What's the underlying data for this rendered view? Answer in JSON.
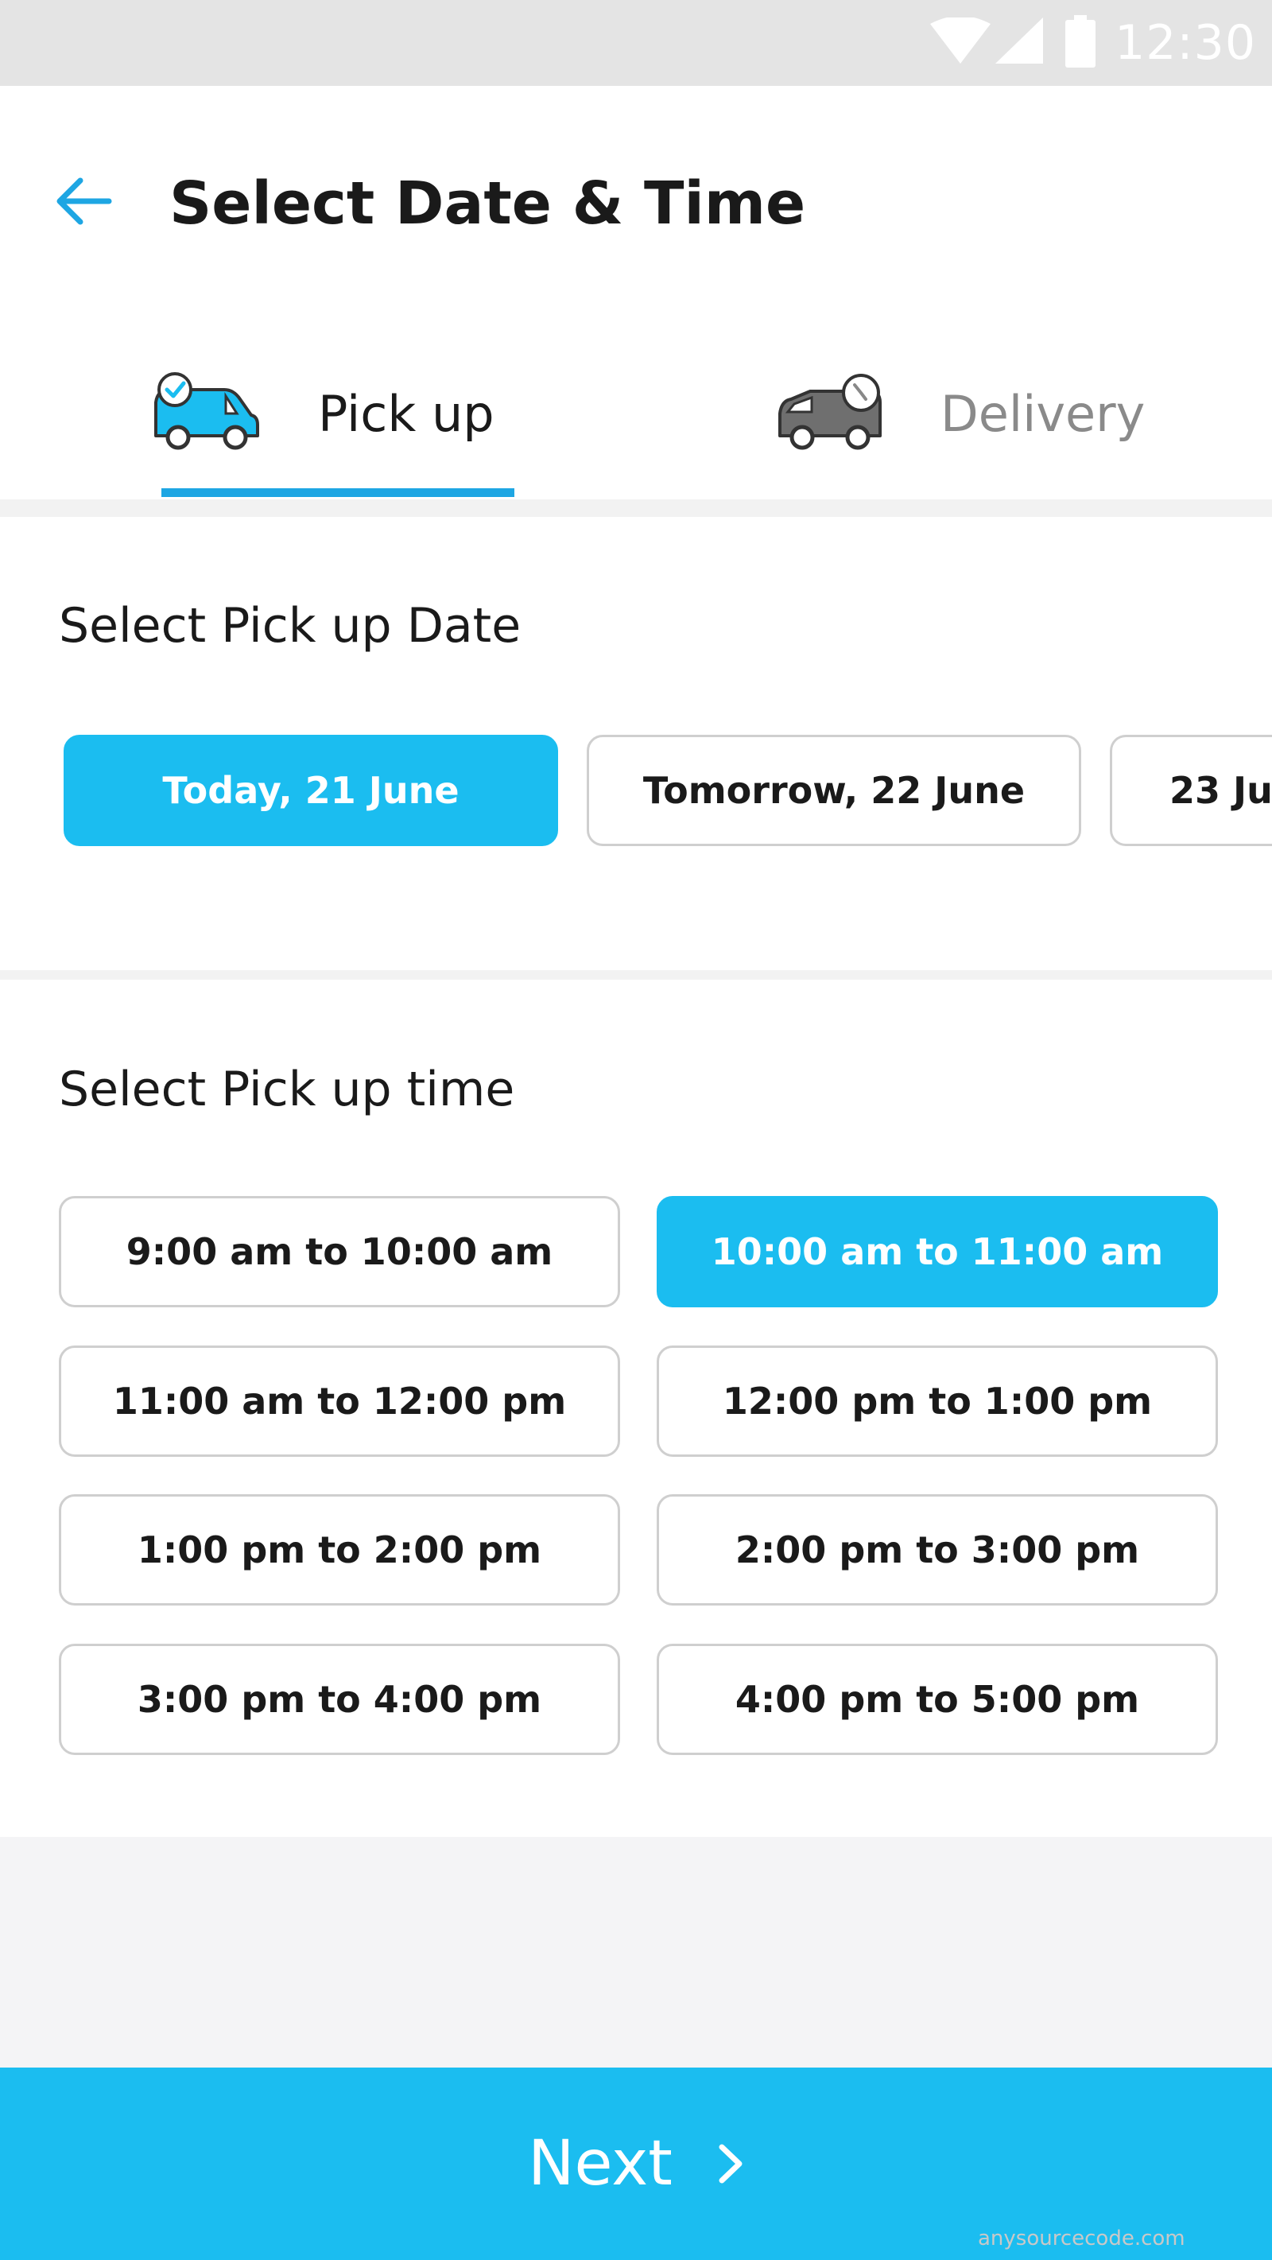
{
  "status_bar": {
    "time": "12:30",
    "icons": [
      "wifi-icon",
      "signal-icon",
      "battery-icon"
    ]
  },
  "header": {
    "title": "Select Date & Time",
    "back_icon": "arrow-left-icon"
  },
  "tabs": [
    {
      "label": "Pick up",
      "icon": "van-check-icon",
      "active": true
    },
    {
      "label": "Delivery",
      "icon": "van-clock-icon",
      "active": false
    }
  ],
  "date_section": {
    "title": "Select Pick up Date",
    "dates": [
      {
        "label": "Today, 21 June",
        "selected": true
      },
      {
        "label": "Tomorrow, 22 June",
        "selected": false
      },
      {
        "label": "23 Ju",
        "selected": false
      }
    ]
  },
  "time_section": {
    "title": "Select Pick up time",
    "slots": [
      {
        "label": "9:00 am to 10:00 am",
        "selected": false
      },
      {
        "label": "10:00 am to 11:00 am",
        "selected": true
      },
      {
        "label": "11:00 am to 12:00 pm",
        "selected": false
      },
      {
        "label": "12:00 pm to 1:00 pm",
        "selected": false
      },
      {
        "label": "1:00 pm to 2:00 pm",
        "selected": false
      },
      {
        "label": "2:00 pm to 3:00 pm",
        "selected": false
      },
      {
        "label": "3:00 pm to 4:00 pm",
        "selected": false
      },
      {
        "label": "4:00 pm to 5:00 pm",
        "selected": false
      }
    ]
  },
  "next_button": {
    "label": "Next",
    "icon": "chevron-right-icon"
  },
  "watermark": "anysourcecode.com",
  "colors": {
    "accent": "#1bbdf0",
    "indicator": "#1ea6e3",
    "back_arrow": "#1ea6e3"
  }
}
